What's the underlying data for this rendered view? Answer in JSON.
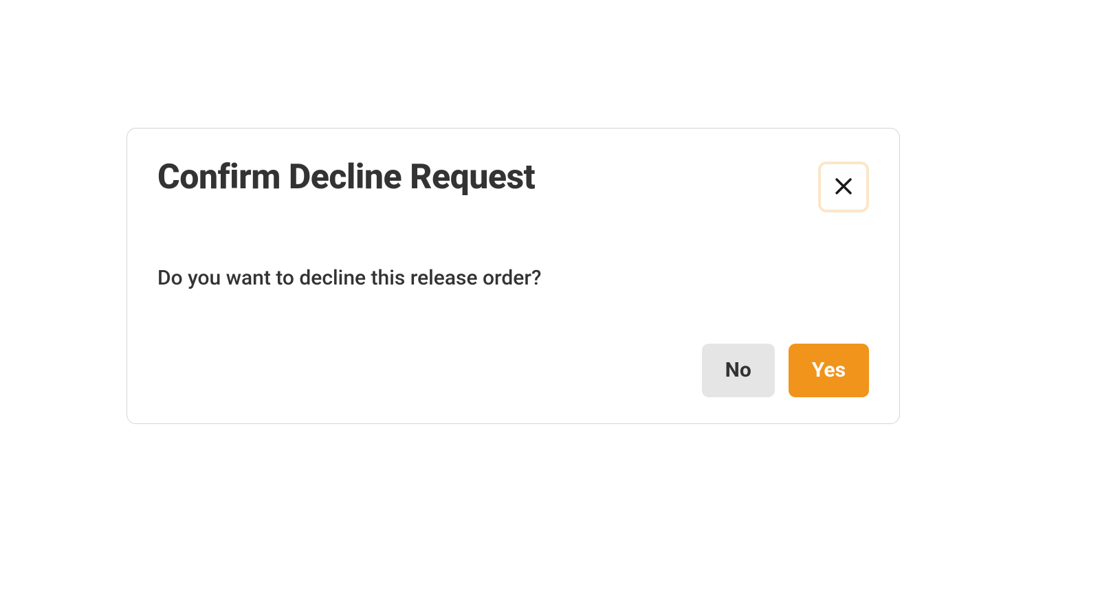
{
  "dialog": {
    "title": "Confirm Decline Request",
    "message": "Do you want to decline this release order?",
    "buttons": {
      "no_label": "No",
      "yes_label": "Yes"
    }
  }
}
